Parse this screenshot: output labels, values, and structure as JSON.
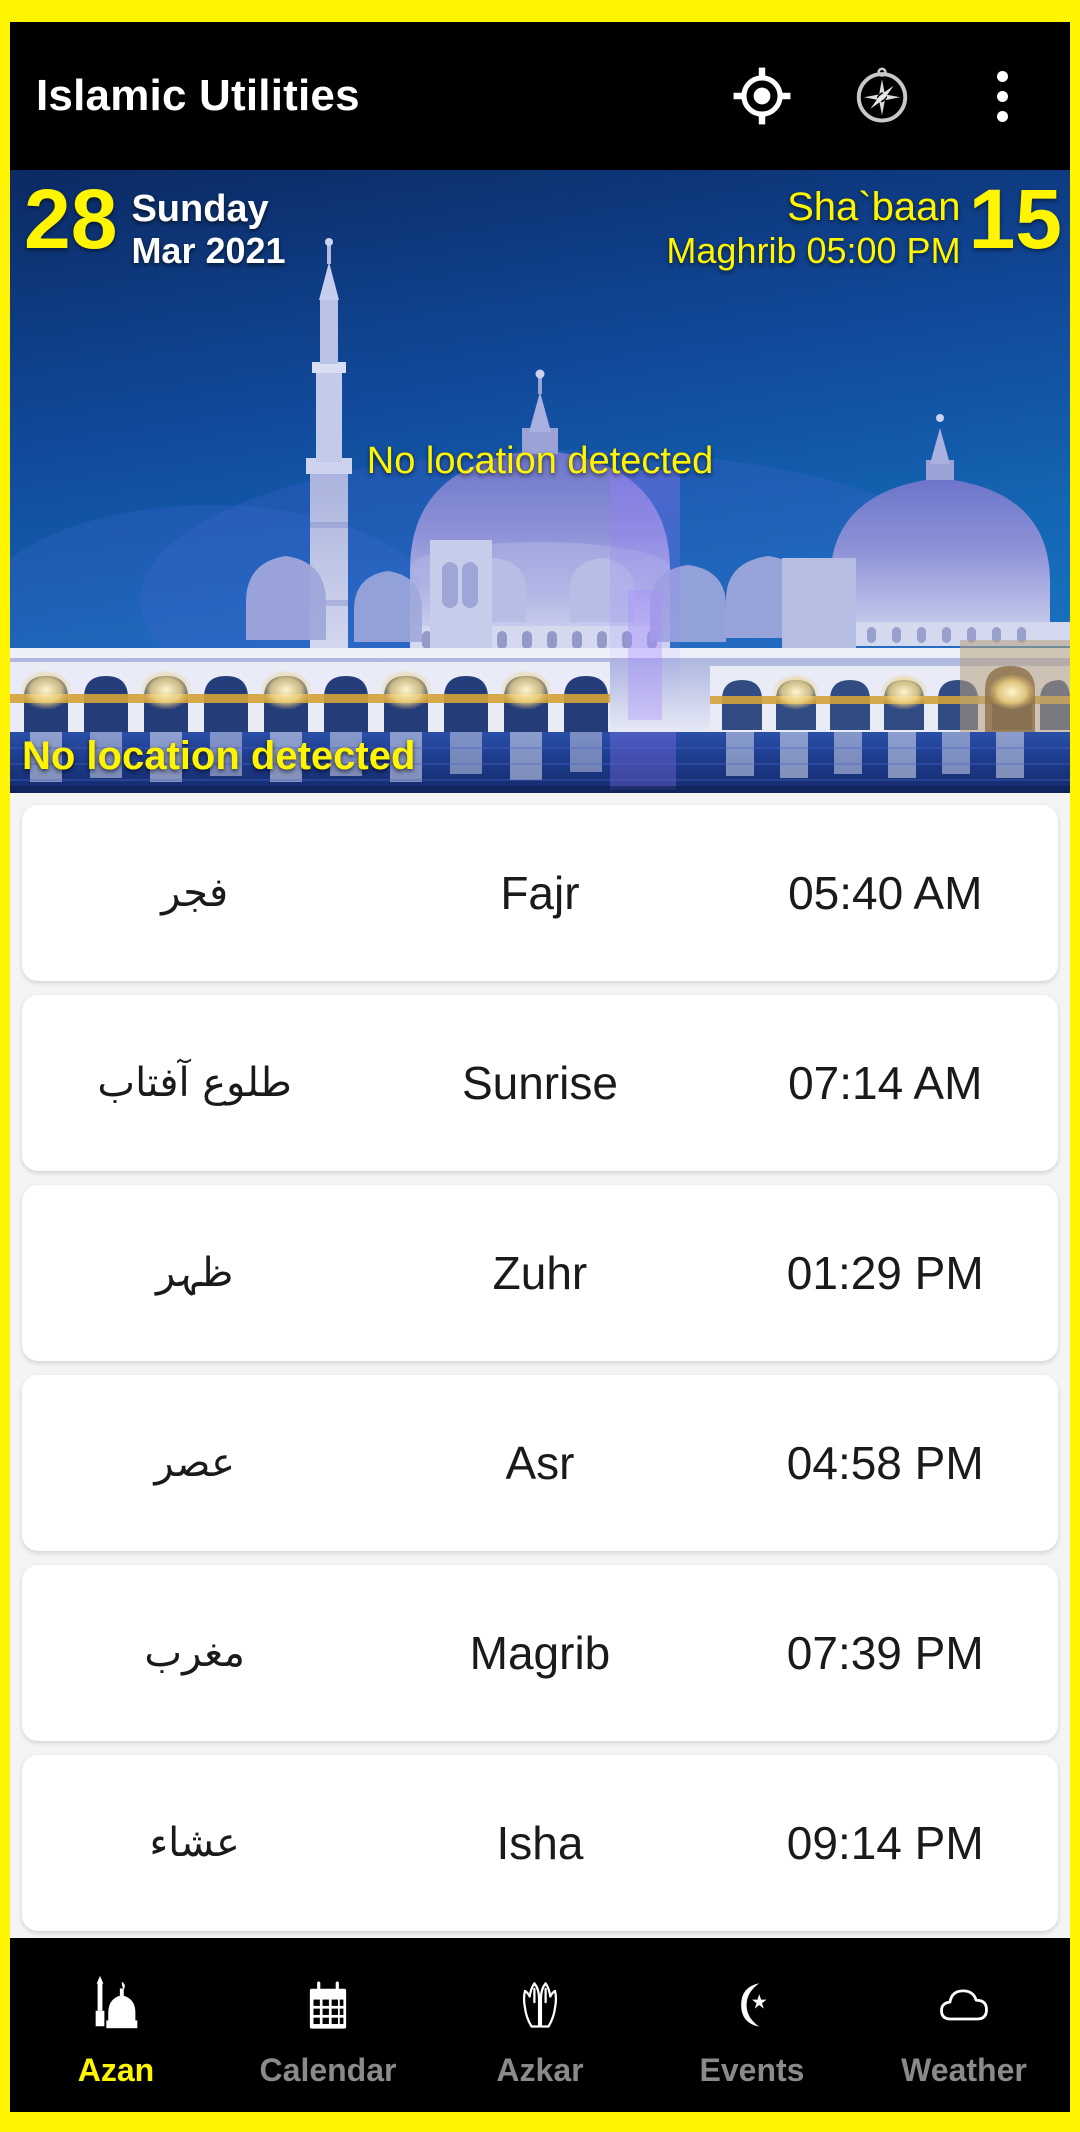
{
  "theme": {
    "accent": "#FFF500",
    "appbar_bg": "#000000",
    "card_bg": "#ffffff",
    "list_bg": "#f4f4f4",
    "nav_inactive": "#8a8a8a"
  },
  "appbar": {
    "title": "Islamic Utilities",
    "actions": [
      {
        "name": "location-icon",
        "label": "Detect location"
      },
      {
        "name": "compass-icon",
        "label": "Qibla compass"
      },
      {
        "name": "overflow-menu-icon",
        "label": "More options"
      }
    ]
  },
  "hero": {
    "gregorian": {
      "day": "28",
      "weekday": "Sunday",
      "month": "Mar",
      "year": "2021"
    },
    "hijri": {
      "month": "Sha`baan",
      "day": "15",
      "next_prayer_label": "Maghrib",
      "next_prayer_time": "05:00 PM",
      "next_prayer_line": "Maghrib 05:00 PM"
    },
    "location_center": "No location detected",
    "location_bottom": "No location detected",
    "image_alt": "Sheikh Zayed Grand Mosque illuminated at night"
  },
  "prayers": [
    {
      "arabic": "فجر",
      "english": "Fajr",
      "time": "05:40 AM"
    },
    {
      "arabic": "طلوع آفتاب",
      "english": "Sunrise",
      "time": "07:14 AM"
    },
    {
      "arabic": "ظہر",
      "english": "Zuhr",
      "time": "01:29 PM"
    },
    {
      "arabic": "عصر",
      "english": "Asr",
      "time": "04:58 PM"
    },
    {
      "arabic": "مغرب",
      "english": "Magrib",
      "time": "07:39 PM"
    },
    {
      "arabic": "عشاء",
      "english": "Isha",
      "time": "09:14 PM"
    }
  ],
  "bottom_nav": {
    "active": "Azan",
    "items": [
      {
        "label": "Azan",
        "icon": "mosque-icon",
        "active": true
      },
      {
        "label": "Calendar",
        "icon": "calendar-icon",
        "active": false
      },
      {
        "label": "Azkar",
        "icon": "praying-hands-icon",
        "active": false
      },
      {
        "label": "Events",
        "icon": "crescent-moon-icon",
        "active": false
      },
      {
        "label": "Weather",
        "icon": "cloud-icon",
        "active": false
      }
    ]
  }
}
